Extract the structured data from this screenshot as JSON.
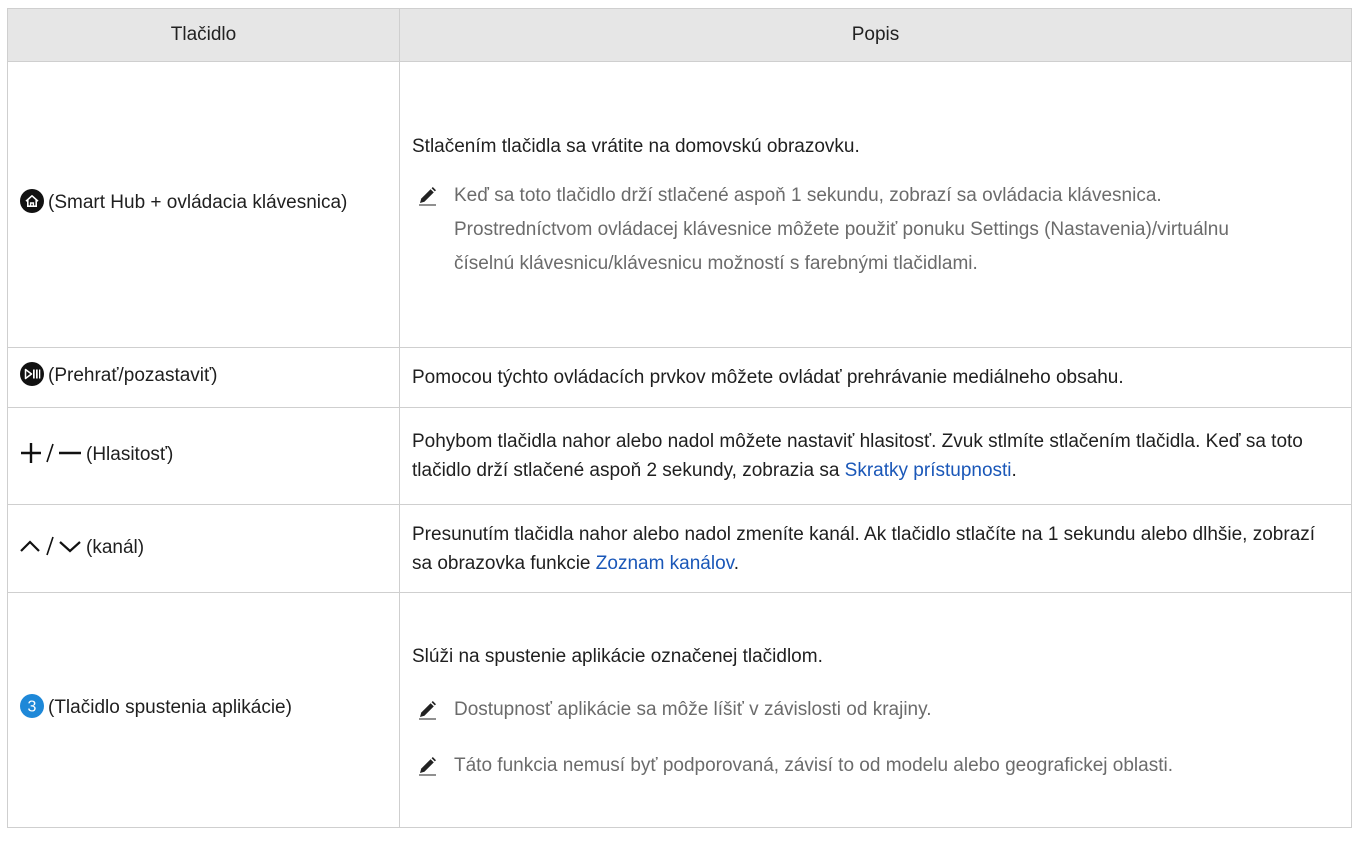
{
  "table": {
    "headers": {
      "button": "Tlačidlo",
      "description": "Popis"
    },
    "rows": [
      {
        "button_label": "(Smart Hub + ovládacia klávesnica)",
        "icon": "home-icon",
        "description": "Stlačením tlačidla sa vrátite na domovskú obrazovku.",
        "notes": [
          "Keď sa toto tlačidlo drží stlačené aspoň 1 sekundu, zobrazí sa ovládacia klávesnica. Prostredníctvom ovládacej klávesnice môžete použiť ponuku Settings (Nastavenia)/virtuálnu číselnú klávesnicu/klávesnicu možností s farebnými tlačidlami."
        ]
      },
      {
        "button_label": "(Prehrať/pozastaviť)",
        "icon": "play-pause-icon",
        "description": "Pomocou týchto ovládacích prvkov môžete ovládať prehrávanie mediálneho obsahu."
      },
      {
        "button_label": "(Hlasitosť)",
        "icon": "volume-plus-minus-icon",
        "description_before": "Pohybom tlačidla nahor alebo nadol môžete nastaviť hlasitosť. Zvuk stlmíte stlačením tlačidla. Keď sa toto tlačidlo drží stlačené aspoň 2 sekundy, zobrazia sa ",
        "link": "Skratky prístupnosti",
        "description_after": "."
      },
      {
        "button_label": "(kanál)",
        "icon": "channel-up-down-icon",
        "description_before": "Presunutím tlačidla nahor alebo nadol zmeníte kanál. Ak tlačidlo stlačíte na 1 sekundu alebo dlhšie, zobrazí sa obrazovka funkcie ",
        "link": "Zoznam kanálov",
        "description_after": "."
      },
      {
        "button_label": "(Tlačidlo spustenia aplikácie)",
        "icon": "app-launch-3-icon",
        "icon_digit": "3",
        "description": "Slúži na spustenie aplikácie označenej tlačidlom.",
        "notes": [
          "Dostupnosť aplikácie sa môže líšiť v závislosti od krajiny.",
          "Táto funkcia nemusí byť podporovaná, závisí to od modelu alebo geografickej oblasti."
        ]
      }
    ]
  },
  "colors": {
    "header_bg": "#e6e6e6",
    "border": "#cfcfcf",
    "link": "#1a57b8",
    "note_text": "#6b6b6b",
    "icon_fill": "#111111",
    "app_icon_fill": "#1e88d8"
  }
}
